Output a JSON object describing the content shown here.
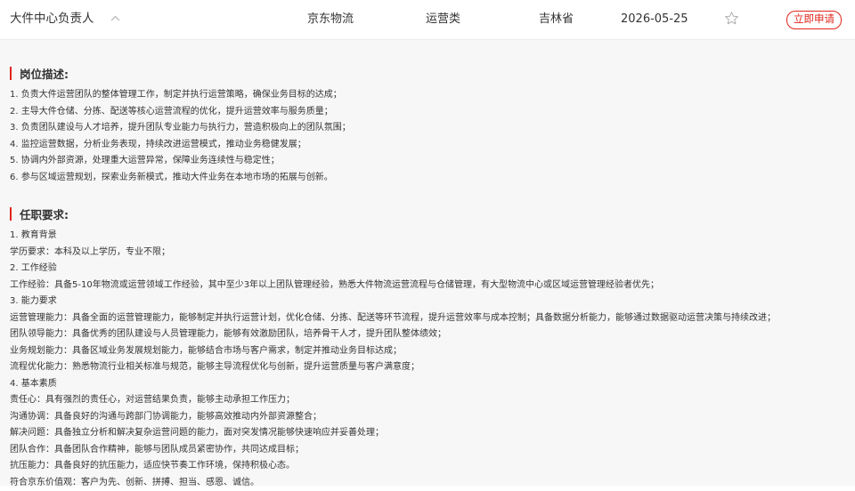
{
  "header": {
    "job_title": "大件中心负责人",
    "company": "京东物流",
    "category": "运营类",
    "location": "吉林省",
    "date": "2026-05-25",
    "apply_label": "立即申请"
  },
  "colors": {
    "accent": "#e1251b",
    "background": "#f7f7f7",
    "text": "#333333"
  },
  "description": {
    "title": "岗位描述:",
    "lines": [
      "1. 负责大件运营团队的整体管理工作，制定并执行运营策略，确保业务目标的达成；",
      "2. 主导大件仓储、分拣、配送等核心运营流程的优化，提升运营效率与服务质量；",
      "3. 负责团队建设与人才培养，提升团队专业能力与执行力，营造积极向上的团队氛围；",
      "4. 监控运营数据，分析业务表现，持续改进运营模式，推动业务稳健发展；",
      "5. 协调内外部资源，处理重大运营异常，保障业务连续性与稳定性；",
      "6. 参与区域运营规划，探索业务新模式，推动大件业务在本地市场的拓展与创新。"
    ]
  },
  "requirements": {
    "title": "任职要求:",
    "lines": [
      "1. 教育背景",
      "学历要求：本科及以上学历，专业不限；",
      "2. 工作经验",
      "工作经验：具备5-10年物流或运营领域工作经验，其中至少3年以上团队管理经验，熟悉大件物流运营流程与仓储管理，有大型物流中心或区域运营管理经验者优先；",
      "3. 能力要求",
      "运营管理能力：具备全面的运营管理能力，能够制定并执行运营计划，优化仓储、分拣、配送等环节流程，提升运营效率与成本控制；具备数据分析能力，能够通过数据驱动运营决策与持续改进；",
      "团队领导能力：具备优秀的团队建设与人员管理能力，能够有效激励团队，培养骨干人才，提升团队整体绩效；",
      "业务规划能力：具备区域业务发展规划能力，能够结合市场与客户需求，制定并推动业务目标达成；",
      "流程优化能力：熟悉物流行业相关标准与规范，能够主导流程优化与创新，提升运营质量与客户满意度；",
      "4. 基本素质",
      "责任心：具有强烈的责任心，对运营结果负责，能够主动承担工作压力；",
      "沟通协调：具备良好的沟通与跨部门协调能力，能够高效推动内外部资源整合；",
      "解决问题：具备独立分析和解决复杂运营问题的能力，面对突发情况能够快速响应并妥善处理；",
      "团队合作：具备团队合作精神，能够与团队成员紧密协作，共同达成目标；",
      "抗压能力：具备良好的抗压能力，适应快节奏工作环境，保持积极心态。",
      "符合京东价值观：客户为先、创新、拼搏、担当、感恩、诚信。"
    ]
  }
}
